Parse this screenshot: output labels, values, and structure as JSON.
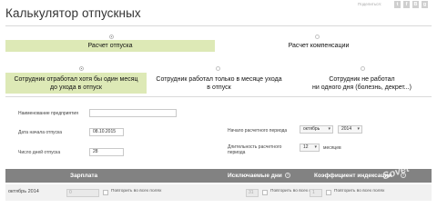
{
  "header": {
    "title": "Калькулятор отпускных",
    "share_label": "Поделиться:",
    "social": [
      "t",
      "f",
      "B",
      "g"
    ]
  },
  "calc_type": {
    "options": [
      "Расчет отпуска",
      "Расчет компенсации"
    ],
    "selected": 0
  },
  "work_mode": {
    "options": [
      {
        "line1": "Сотрудник отработал хотя бы один месяц",
        "line2": "до ухода в отпуск"
      },
      {
        "line1": "Сотрудник работал только в месяце ухода",
        "line2": "в отпуск"
      },
      {
        "line1": "Сотрудник не работал",
        "line2": "ни одного дня (болезнь, декрет...)"
      }
    ],
    "selected": 0
  },
  "form": {
    "company_label": "Наименование предприятия",
    "company_value": "",
    "start_label": "Дата начала отпуска",
    "start_value": "08.10.2015",
    "days_label": "Число дней отпуска",
    "days_value": "28",
    "period_start_label": "Начало расчетного периода",
    "period_month": "октябрь",
    "period_year": "2014",
    "duration_label": "Длительность расчетного периода",
    "duration_value": "12",
    "duration_unit": "месяцев"
  },
  "table": {
    "headers": [
      "Зарплата",
      "Исключаемые дни",
      "Коэффициент индексации"
    ],
    "help_icon": "question-icon",
    "rows": [
      {
        "month": "октябрь 2014",
        "salary": "0",
        "repeat_label": "Повторить во всех полях",
        "excluded": "31",
        "coef": "1"
      }
    ]
  },
  "watermark": "Sovet",
  "colors": {
    "accent": "#dde9b6",
    "table_header": "#828282"
  }
}
